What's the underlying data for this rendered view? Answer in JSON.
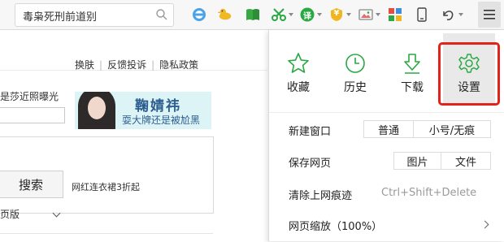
{
  "toolbar": {
    "search_text": "毒枭死刑前道别",
    "icons": [
      "search-icon",
      "browser-icon",
      "duck-icon",
      "book-icon",
      "scissors-icon",
      "translate-icon",
      "shield-icon",
      "image-icon",
      "apps-icon",
      "phone-icon",
      "undo-icon",
      "menu-icon"
    ],
    "translate_label": "译",
    "shield_label": "¥"
  },
  "webpage": {
    "links": [
      "换肤",
      "反馈投诉",
      "隐私政策"
    ],
    "news_snippet": "是莎近照曝光",
    "banner_name": "鞠婧祎",
    "banner_sub": "耍大牌还是被尬黑",
    "search_button": "搜索",
    "hot_text": "网红连衣裙3折起",
    "version_text": "页版"
  },
  "menu": {
    "quick_actions": [
      {
        "label": "收藏",
        "icon": "star-icon"
      },
      {
        "label": "历史",
        "icon": "clock-icon"
      },
      {
        "label": "下载",
        "icon": "download-icon"
      },
      {
        "label": "设置",
        "icon": "gear-icon"
      }
    ],
    "new_window": {
      "label": "新建窗口",
      "options": [
        "普通",
        "小号/无痕"
      ]
    },
    "save_page": {
      "label": "保存网页",
      "options": [
        "图片",
        "文件"
      ]
    },
    "clear_traces": {
      "label": "清除上网痕迹",
      "shortcut": "Ctrl+Shift+Delete"
    },
    "zoom": {
      "label": "网页缩放（100%）"
    },
    "accent_color": "#2aa843",
    "highlight_color": "#e2231a"
  }
}
